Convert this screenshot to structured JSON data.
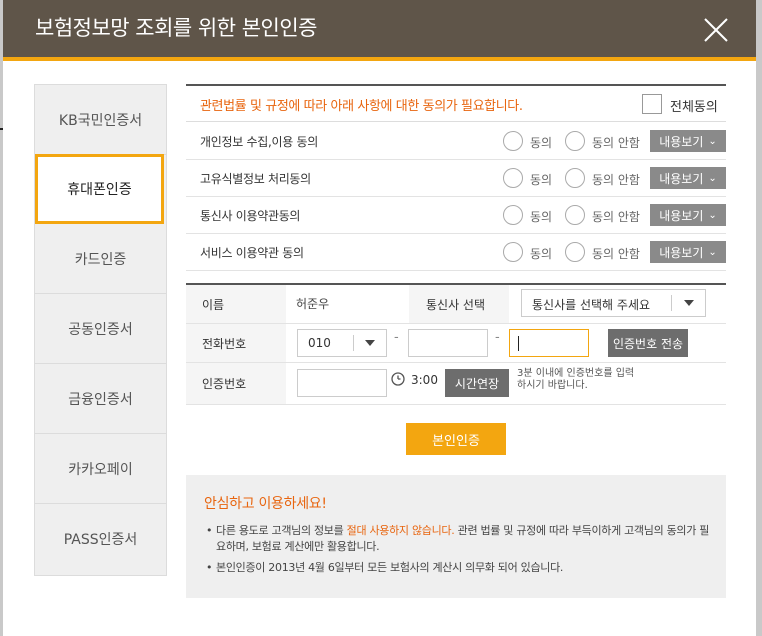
{
  "header": {
    "title": "보험정보망 조회를 위한 본인인증"
  },
  "sidebar": {
    "items": [
      {
        "label": "KB국민인증서"
      },
      {
        "label": "휴대폰인증"
      },
      {
        "label": "카드인증"
      },
      {
        "label": "공동인증서"
      },
      {
        "label": "금융인증서"
      },
      {
        "label": "카카오페이"
      },
      {
        "label": "PASS인증서"
      }
    ],
    "active": "휴대폰인증"
  },
  "agreement": {
    "notice": "관련법률 및 규정에 따라 아래 사항에 대한 동의가 필요합니다.",
    "all_label": "전체동의",
    "agree_label": "동의",
    "disagree_label": "동의 안함",
    "view_label": "내용보기",
    "rows": [
      {
        "label": "개인정보 수집,이용 동의"
      },
      {
        "label": "고유식별정보 처리동의"
      },
      {
        "label": "통신사 이용약관동의"
      },
      {
        "label": "서비스 이용약관 동의"
      }
    ]
  },
  "form": {
    "name_label": "이름",
    "name_value": "허준우",
    "carrier_label": "통신사 선택",
    "carrier_value": "통신사를 선택해 주세요",
    "phone_label": "전화번호",
    "phone_prefix": "010",
    "dash": "-",
    "send_button": "인증번호 전송",
    "code_label": "인증번호",
    "timer": "3:00",
    "extend_button": "시간연장",
    "hint": "3분 이내에 인증번호를 입력하시기 바랍니다."
  },
  "submit_label": "본인인증",
  "safety": {
    "title": "안심하고 이용하세요!",
    "bullet": "•",
    "item1_a": "다른 용도로 고객님의 정보를 ",
    "item1_em": "절대 사용하지 않습니다.",
    "item1_b": " 관련 법률 및 규정에 따라 부득이하게 고객님의 동의가 필요하며, 보험료 계산에만 활용합니다.",
    "item2": "본인인증이 2013년 4월 6일부터 모든 보험사의 계산시 의무화 되어 있습니다."
  },
  "colors": {
    "accent": "#f3a610",
    "header": "#5f5549",
    "notice": "#e8650f"
  }
}
